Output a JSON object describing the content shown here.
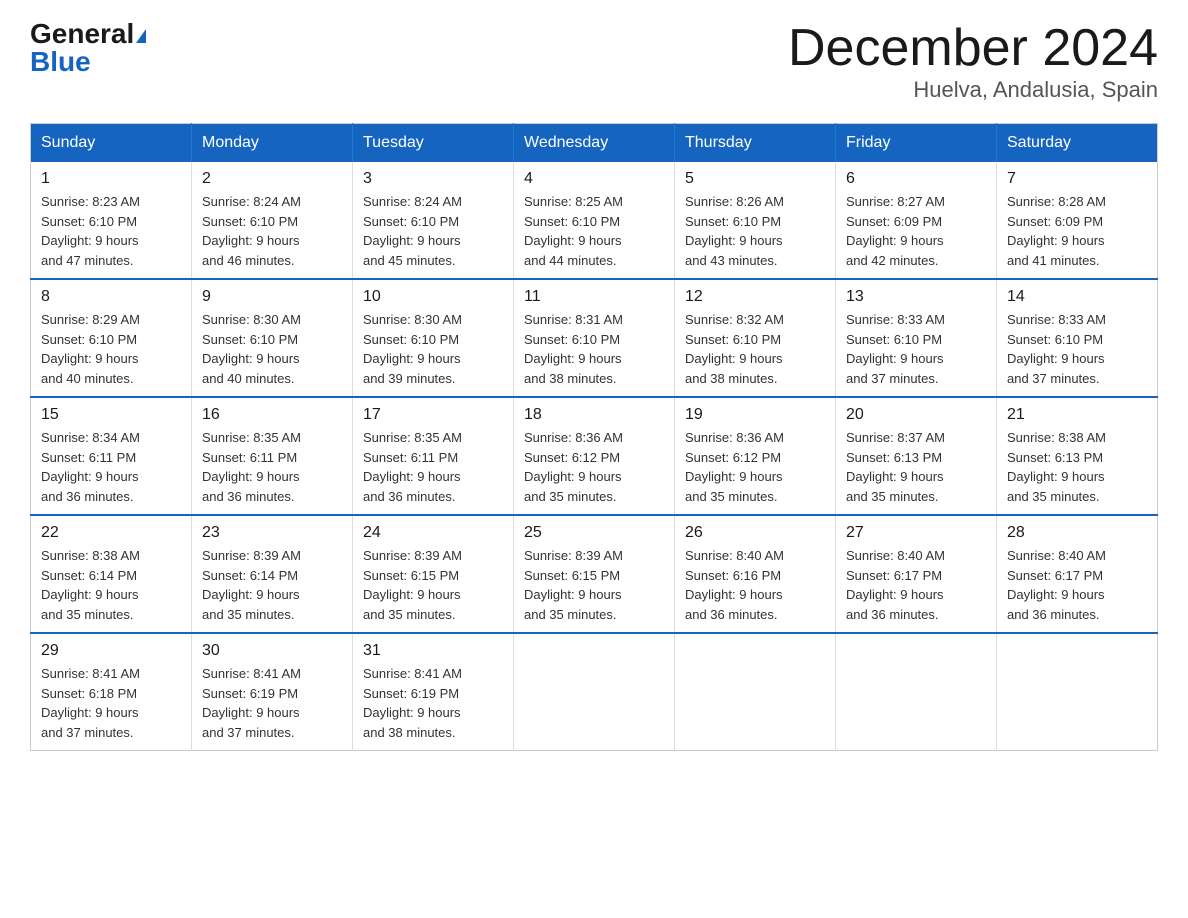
{
  "header": {
    "logo_general": "General",
    "logo_blue": "Blue",
    "month_title": "December 2024",
    "location": "Huelva, Andalusia, Spain"
  },
  "days_of_week": [
    "Sunday",
    "Monday",
    "Tuesday",
    "Wednesday",
    "Thursday",
    "Friday",
    "Saturday"
  ],
  "weeks": [
    [
      {
        "day": "1",
        "info": "Sunrise: 8:23 AM\nSunset: 6:10 PM\nDaylight: 9 hours\nand 47 minutes."
      },
      {
        "day": "2",
        "info": "Sunrise: 8:24 AM\nSunset: 6:10 PM\nDaylight: 9 hours\nand 46 minutes."
      },
      {
        "day": "3",
        "info": "Sunrise: 8:24 AM\nSunset: 6:10 PM\nDaylight: 9 hours\nand 45 minutes."
      },
      {
        "day": "4",
        "info": "Sunrise: 8:25 AM\nSunset: 6:10 PM\nDaylight: 9 hours\nand 44 minutes."
      },
      {
        "day": "5",
        "info": "Sunrise: 8:26 AM\nSunset: 6:10 PM\nDaylight: 9 hours\nand 43 minutes."
      },
      {
        "day": "6",
        "info": "Sunrise: 8:27 AM\nSunset: 6:09 PM\nDaylight: 9 hours\nand 42 minutes."
      },
      {
        "day": "7",
        "info": "Sunrise: 8:28 AM\nSunset: 6:09 PM\nDaylight: 9 hours\nand 41 minutes."
      }
    ],
    [
      {
        "day": "8",
        "info": "Sunrise: 8:29 AM\nSunset: 6:10 PM\nDaylight: 9 hours\nand 40 minutes."
      },
      {
        "day": "9",
        "info": "Sunrise: 8:30 AM\nSunset: 6:10 PM\nDaylight: 9 hours\nand 40 minutes."
      },
      {
        "day": "10",
        "info": "Sunrise: 8:30 AM\nSunset: 6:10 PM\nDaylight: 9 hours\nand 39 minutes."
      },
      {
        "day": "11",
        "info": "Sunrise: 8:31 AM\nSunset: 6:10 PM\nDaylight: 9 hours\nand 38 minutes."
      },
      {
        "day": "12",
        "info": "Sunrise: 8:32 AM\nSunset: 6:10 PM\nDaylight: 9 hours\nand 38 minutes."
      },
      {
        "day": "13",
        "info": "Sunrise: 8:33 AM\nSunset: 6:10 PM\nDaylight: 9 hours\nand 37 minutes."
      },
      {
        "day": "14",
        "info": "Sunrise: 8:33 AM\nSunset: 6:10 PM\nDaylight: 9 hours\nand 37 minutes."
      }
    ],
    [
      {
        "day": "15",
        "info": "Sunrise: 8:34 AM\nSunset: 6:11 PM\nDaylight: 9 hours\nand 36 minutes."
      },
      {
        "day": "16",
        "info": "Sunrise: 8:35 AM\nSunset: 6:11 PM\nDaylight: 9 hours\nand 36 minutes."
      },
      {
        "day": "17",
        "info": "Sunrise: 8:35 AM\nSunset: 6:11 PM\nDaylight: 9 hours\nand 36 minutes."
      },
      {
        "day": "18",
        "info": "Sunrise: 8:36 AM\nSunset: 6:12 PM\nDaylight: 9 hours\nand 35 minutes."
      },
      {
        "day": "19",
        "info": "Sunrise: 8:36 AM\nSunset: 6:12 PM\nDaylight: 9 hours\nand 35 minutes."
      },
      {
        "day": "20",
        "info": "Sunrise: 8:37 AM\nSunset: 6:13 PM\nDaylight: 9 hours\nand 35 minutes."
      },
      {
        "day": "21",
        "info": "Sunrise: 8:38 AM\nSunset: 6:13 PM\nDaylight: 9 hours\nand 35 minutes."
      }
    ],
    [
      {
        "day": "22",
        "info": "Sunrise: 8:38 AM\nSunset: 6:14 PM\nDaylight: 9 hours\nand 35 minutes."
      },
      {
        "day": "23",
        "info": "Sunrise: 8:39 AM\nSunset: 6:14 PM\nDaylight: 9 hours\nand 35 minutes."
      },
      {
        "day": "24",
        "info": "Sunrise: 8:39 AM\nSunset: 6:15 PM\nDaylight: 9 hours\nand 35 minutes."
      },
      {
        "day": "25",
        "info": "Sunrise: 8:39 AM\nSunset: 6:15 PM\nDaylight: 9 hours\nand 35 minutes."
      },
      {
        "day": "26",
        "info": "Sunrise: 8:40 AM\nSunset: 6:16 PM\nDaylight: 9 hours\nand 36 minutes."
      },
      {
        "day": "27",
        "info": "Sunrise: 8:40 AM\nSunset: 6:17 PM\nDaylight: 9 hours\nand 36 minutes."
      },
      {
        "day": "28",
        "info": "Sunrise: 8:40 AM\nSunset: 6:17 PM\nDaylight: 9 hours\nand 36 minutes."
      }
    ],
    [
      {
        "day": "29",
        "info": "Sunrise: 8:41 AM\nSunset: 6:18 PM\nDaylight: 9 hours\nand 37 minutes."
      },
      {
        "day": "30",
        "info": "Sunrise: 8:41 AM\nSunset: 6:19 PM\nDaylight: 9 hours\nand 37 minutes."
      },
      {
        "day": "31",
        "info": "Sunrise: 8:41 AM\nSunset: 6:19 PM\nDaylight: 9 hours\nand 38 minutes."
      },
      null,
      null,
      null,
      null
    ]
  ]
}
